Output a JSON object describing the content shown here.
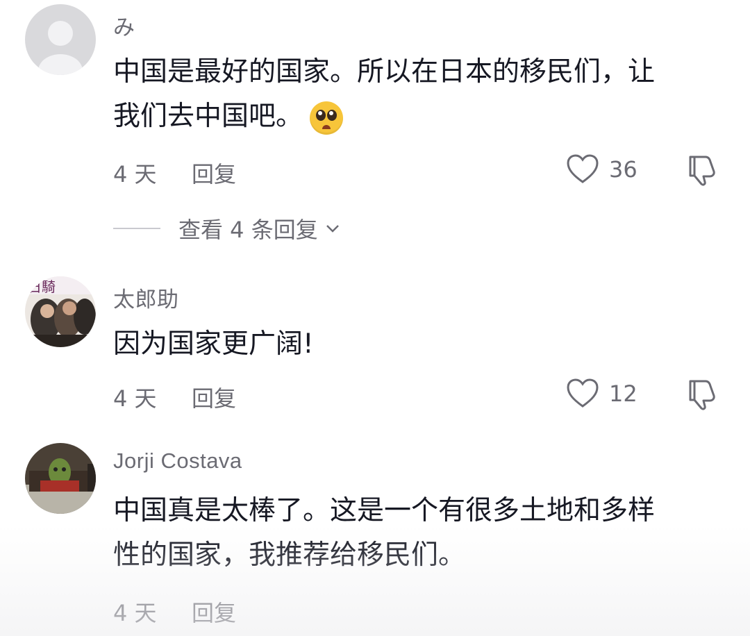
{
  "comments": [
    {
      "username": "み",
      "text_line1": "中国是最好的国家。所以在日本的移民们，让",
      "text_line2": "我们去中国吧。",
      "emoji": "pleading-face",
      "time": "4 天",
      "reply_label": "回复",
      "likes": "36",
      "view_replies": "查看 4 条回复"
    },
    {
      "username": "太郎助",
      "text_line1": "因为国家更广阔!",
      "time": "4 天",
      "reply_label": "回复",
      "likes": "12"
    },
    {
      "username": "Jorji Costava",
      "text_line1": "中国真是太棒了。这是一个有很多土地和多样",
      "text_line2": "性的国家，我推荐给移民们。",
      "time": "4 天",
      "reply_label": "回复"
    }
  ],
  "colors": {
    "text": "#161823",
    "secondary": "#6b6b73",
    "emoji": "#f7c53a"
  }
}
